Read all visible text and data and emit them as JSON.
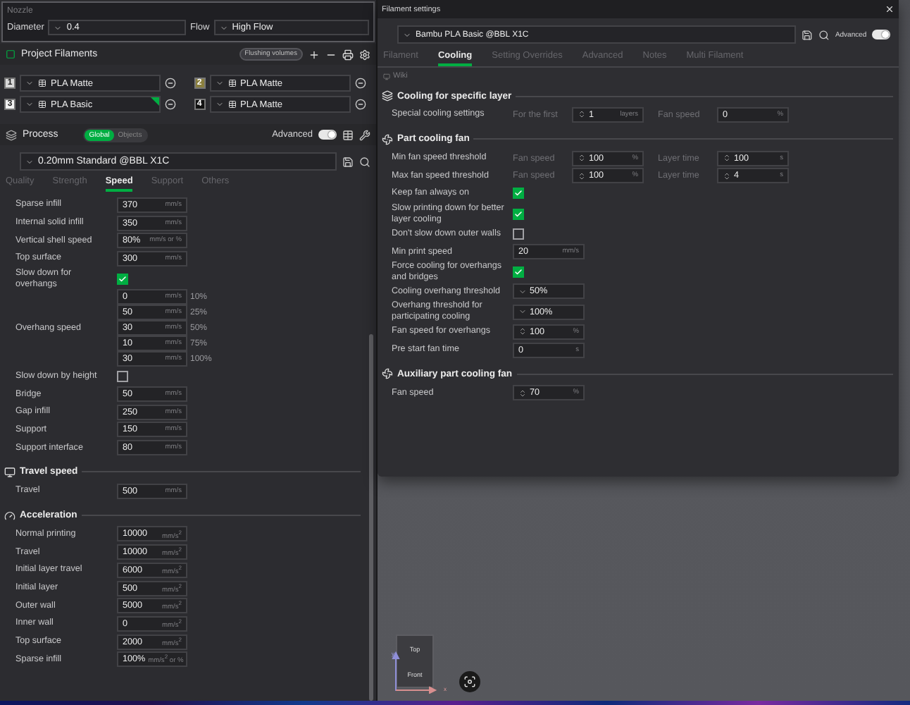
{
  "nozzle": {
    "title": "Nozzle",
    "fields": [
      {
        "label": "Diameter",
        "value": "0.4"
      },
      {
        "label": "Flow",
        "value": "High Flow"
      }
    ]
  },
  "filaments": {
    "title": "Project Filaments",
    "flushing_button": "Flushing volumes",
    "items": [
      {
        "number": "1",
        "color": "#d9d9d9",
        "name": "PLA Matte",
        "selected": false
      },
      {
        "number": "2",
        "color": "#8a7f3e",
        "name": "PLA Matte",
        "selected": false
      },
      {
        "number": "3",
        "color": "#f2f2f2",
        "name": "PLA Basic",
        "selected": true
      },
      {
        "number": "4",
        "color": "#111111",
        "name": "PLA Matte",
        "selected": false
      }
    ]
  },
  "process": {
    "title": "Process",
    "scope": [
      {
        "label": "Global",
        "selected": true
      },
      {
        "label": "Objects",
        "selected": false
      }
    ],
    "advanced": {
      "label": "Advanced",
      "on": true
    },
    "preset": "0.20mm Standard @BBL X1C",
    "tabs": [
      {
        "label": "Quality",
        "selected": false
      },
      {
        "label": "Strength",
        "selected": false
      },
      {
        "label": "Speed",
        "selected": true
      },
      {
        "label": "Support",
        "selected": false
      },
      {
        "label": "Others",
        "selected": false
      }
    ],
    "sections": [
      {
        "rows": [
          {
            "kind": "field",
            "label": "Sparse infill",
            "control": {
              "kind": "text",
              "value": "370",
              "unit": "mm/s"
            }
          },
          {
            "kind": "field",
            "label": "Internal solid infill",
            "control": {
              "kind": "text",
              "value": "350",
              "unit": "mm/s"
            }
          },
          {
            "kind": "field",
            "label": "Vertical shell speed",
            "control": {
              "kind": "text",
              "value": "80%",
              "unit": "mm/s or %"
            }
          },
          {
            "kind": "field",
            "label": "Top surface",
            "control": {
              "kind": "text",
              "value": "300",
              "unit": "mm/s"
            }
          },
          {
            "kind": "check",
            "label": "Slow down for overhangs",
            "checked": true
          },
          {
            "kind": "multi",
            "label": "Overhang speed",
            "controls": [
              {
                "kind": "text",
                "value": "0",
                "unit": "mm/s",
                "suffix": "10%"
              },
              {
                "kind": "text",
                "value": "50",
                "unit": "mm/s",
                "suffix": "25%"
              },
              {
                "kind": "text",
                "value": "30",
                "unit": "mm/s",
                "suffix": "50%"
              },
              {
                "kind": "text",
                "value": "10",
                "unit": "mm/s",
                "suffix": "75%"
              },
              {
                "kind": "text",
                "value": "30",
                "unit": "mm/s",
                "suffix": "100%"
              }
            ]
          },
          {
            "kind": "check",
            "label": "Slow down by height",
            "checked": false
          },
          {
            "kind": "field",
            "label": "Bridge",
            "control": {
              "kind": "text",
              "value": "50",
              "unit": "mm/s"
            }
          },
          {
            "kind": "field",
            "label": "Gap infill",
            "control": {
              "kind": "text",
              "value": "250",
              "unit": "mm/s"
            }
          },
          {
            "kind": "field",
            "label": "Support",
            "control": {
              "kind": "text",
              "value": "150",
              "unit": "mm/s"
            }
          },
          {
            "kind": "field",
            "label": "Support interface",
            "control": {
              "kind": "text",
              "value": "80",
              "unit": "mm/s"
            }
          }
        ]
      },
      {
        "title": "Travel speed",
        "rows": [
          {
            "kind": "field",
            "label": "Travel",
            "control": {
              "kind": "text",
              "value": "500",
              "unit": "mm/s"
            }
          }
        ]
      },
      {
        "title": "Acceleration",
        "rows": [
          {
            "kind": "field",
            "label": "Normal printing",
            "control": {
              "kind": "text",
              "value": "10000",
              "unit": "mm/s$^{2}$"
            }
          },
          {
            "kind": "field",
            "label": "Travel",
            "control": {
              "kind": "text",
              "value": "10000",
              "unit": "mm/s$^{2}$"
            }
          },
          {
            "kind": "field",
            "label": "Initial layer travel",
            "control": {
              "kind": "text",
              "value": "6000",
              "unit": "mm/s$^{2}$"
            }
          },
          {
            "kind": "field",
            "label": "Initial layer",
            "control": {
              "kind": "text",
              "value": "500",
              "unit": "mm/s$^{2}$"
            }
          },
          {
            "kind": "field",
            "label": "Outer wall",
            "control": {
              "kind": "text",
              "value": "5000",
              "unit": "mm/s$^{2}$"
            }
          },
          {
            "kind": "field",
            "label": "Inner wall",
            "control": {
              "kind": "text",
              "value": "0",
              "unit": "mm/s$^{2}$"
            }
          },
          {
            "kind": "field",
            "label": "Top surface",
            "control": {
              "kind": "text",
              "value": "2000",
              "unit": "mm/s$^{2}$"
            }
          },
          {
            "kind": "field",
            "label": "Sparse infill",
            "control": {
              "kind": "text",
              "value": "100%",
              "unit": "mm/s$^{2}$ or %"
            }
          }
        ]
      }
    ]
  },
  "filament_dialog": {
    "title": "Filament settings",
    "preset": "Bambu PLA Basic @BBL X1C",
    "advanced": {
      "label": "Advanced",
      "on": true
    },
    "tabs": [
      {
        "label": "Filament",
        "selected": false
      },
      {
        "label": "Cooling",
        "selected": true
      },
      {
        "label": "Setting Overrides",
        "selected": false
      },
      {
        "label": "Advanced",
        "selected": false
      },
      {
        "label": "Notes",
        "selected": false
      },
      {
        "label": "Multi Filament",
        "selected": false
      }
    ],
    "wiki": "Wiki",
    "sections": [
      {
        "title": "Cooling for specific layer",
        "rows": [
          {
            "kind": "controls",
            "label": "Special cooling settings",
            "controls": [
              {
                "caption": "For the first",
                "kind": "spin",
                "value": "1",
                "unit": "layers"
              },
              {
                "caption": "Fan speed",
                "kind": "text",
                "value": "0",
                "unit": "%"
              }
            ]
          }
        ]
      },
      {
        "title": "Part cooling fan",
        "rows": [
          {
            "kind": "controls",
            "label": "Min fan speed threshold",
            "controls": [
              {
                "caption": "Fan speed",
                "kind": "spin",
                "value": "100",
                "unit": "%"
              },
              {
                "caption": "Layer time",
                "kind": "spin",
                "value": "100",
                "unit": "s"
              }
            ]
          },
          {
            "kind": "controls",
            "label": "Max fan speed threshold",
            "controls": [
              {
                "caption": "Fan speed",
                "kind": "spin",
                "value": "100",
                "unit": "%"
              },
              {
                "caption": "Layer time",
                "kind": "spin",
                "value": "4",
                "unit": "s"
              }
            ]
          },
          {
            "kind": "check",
            "label": "Keep fan always on",
            "checked": true
          },
          {
            "kind": "check",
            "label": "Slow printing down for better layer cooling",
            "checked": true
          },
          {
            "kind": "check",
            "label": "Don't slow down outer walls",
            "checked": false
          },
          {
            "kind": "controls",
            "label": "Min print speed",
            "controls": [
              {
                "kind": "text",
                "value": "20",
                "unit": "mm/s"
              }
            ]
          },
          {
            "kind": "check",
            "label": "Force cooling for overhangs and bridges",
            "checked": true
          },
          {
            "kind": "controls",
            "label": "Cooling overhang threshold",
            "controls": [
              {
                "kind": "select",
                "value": "50%"
              }
            ]
          },
          {
            "kind": "controls",
            "label": "Overhang threshold for participating cooling",
            "controls": [
              {
                "kind": "select",
                "value": "100%"
              }
            ]
          },
          {
            "kind": "controls",
            "label": "Fan speed for overhangs",
            "controls": [
              {
                "kind": "spin",
                "value": "100",
                "unit": "%"
              }
            ]
          },
          {
            "kind": "controls",
            "label": "Pre start fan time",
            "controls": [
              {
                "kind": "text",
                "value": "0",
                "unit": "s"
              }
            ]
          }
        ]
      },
      {
        "title": "Auxiliary part cooling fan",
        "rows": [
          {
            "kind": "controls",
            "label": "Fan speed",
            "controls": [
              {
                "kind": "spin",
                "value": "70",
                "unit": "%"
              }
            ]
          }
        ]
      }
    ]
  },
  "view_cube": {
    "top": "Top",
    "front": "Front",
    "x_axis": "x",
    "y_axis": "y"
  }
}
